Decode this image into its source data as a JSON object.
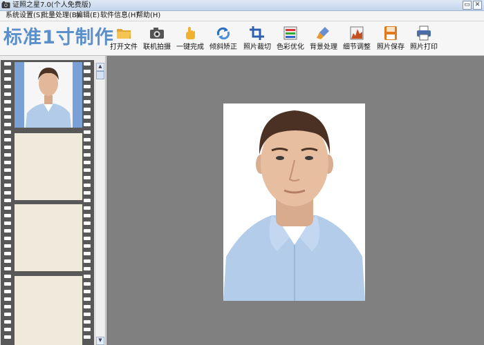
{
  "window": {
    "title": "证照之星7.0(个人免费版)",
    "minimize_glyph": "▭",
    "close_glyph": "✕"
  },
  "menu": [
    {
      "label": "系统设置(S)"
    },
    {
      "label": "批量处理(B)"
    },
    {
      "label": "编辑(E)"
    },
    {
      "label": "软件信息(H)"
    },
    {
      "label": "帮助(H)"
    }
  ],
  "brand": "标准1寸制作",
  "toolbar": [
    {
      "label": "打开文件",
      "icon": "folder-icon"
    },
    {
      "label": "联机拍摄",
      "icon": "camera-icon"
    },
    {
      "label": "一键完成",
      "icon": "hand-pointer-icon"
    },
    {
      "label": "倾斜矫正",
      "icon": "rotate-icon"
    },
    {
      "label": "照片裁切",
      "icon": "crop-icon"
    },
    {
      "label": "色彩优化",
      "icon": "color-bars-icon"
    },
    {
      "label": "背景处理",
      "icon": "brush-icon"
    },
    {
      "label": "细节调整",
      "icon": "histogram-icon"
    },
    {
      "label": "照片保存",
      "icon": "floppy-disk-icon"
    },
    {
      "label": "照片打印",
      "icon": "printer-icon"
    }
  ],
  "colors": {
    "brand": "#5b8fc9",
    "canvas": "#808080",
    "film": "#585858",
    "empty_frame": "#efeadb",
    "thumb_background": "#7aa0d8"
  }
}
